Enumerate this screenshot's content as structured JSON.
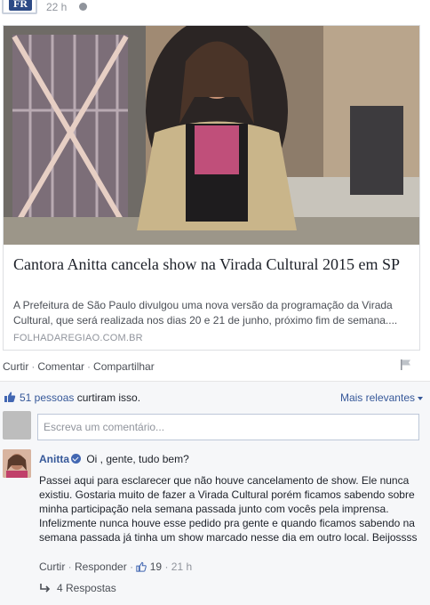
{
  "post": {
    "logo_text": "FR",
    "time": "22 h",
    "privacy_icon": "globe-icon"
  },
  "link_card": {
    "title": "Cantora Anitta cancela show na Virada Cultural 2015 em SP",
    "description": "A Prefeitura de São Paulo divulgou uma nova versão da programação da Virada Cultural, que será realizada nos dias 20 e 21 de junho, próximo fim de semana....",
    "domain": "FOLHADAREGIAO.COM.BR"
  },
  "actions": {
    "like": "Curtir",
    "comment": "Comentar",
    "share": "Compartilhar",
    "flag_icon": "flag-icon"
  },
  "feedback": {
    "likes_count_text": "51 pessoas",
    "likes_suffix": " curtiram isso.",
    "sort_label": "Mais relevantes",
    "comment_placeholder": "Escreva um comentário..."
  },
  "comment": {
    "author": "Anitta",
    "lead": "Oi , gente, tudo bem?",
    "body": "Passei aqui para esclarecer que não houve cancelamento de show. Ele nunca existiu. Gostaria muito de fazer a Virada Cultural porém ficamos sabendo sobre minha participação nela semana passada junto com vocês pela imprensa. Infelizmente nunca houve esse pedido pra gente e quando ficamos sabendo na semana passada já tinha um show marcado nesse dia em outro local. Beijossss",
    "like": "Curtir",
    "reply": "Responder",
    "like_count": "19",
    "time": "21 h",
    "replies": "4 Respostas"
  },
  "colors": {
    "link_blue": "#365899",
    "fb_blue": "#4267b2",
    "muted": "#90949c",
    "feedback_bg": "#f6f7f9"
  }
}
